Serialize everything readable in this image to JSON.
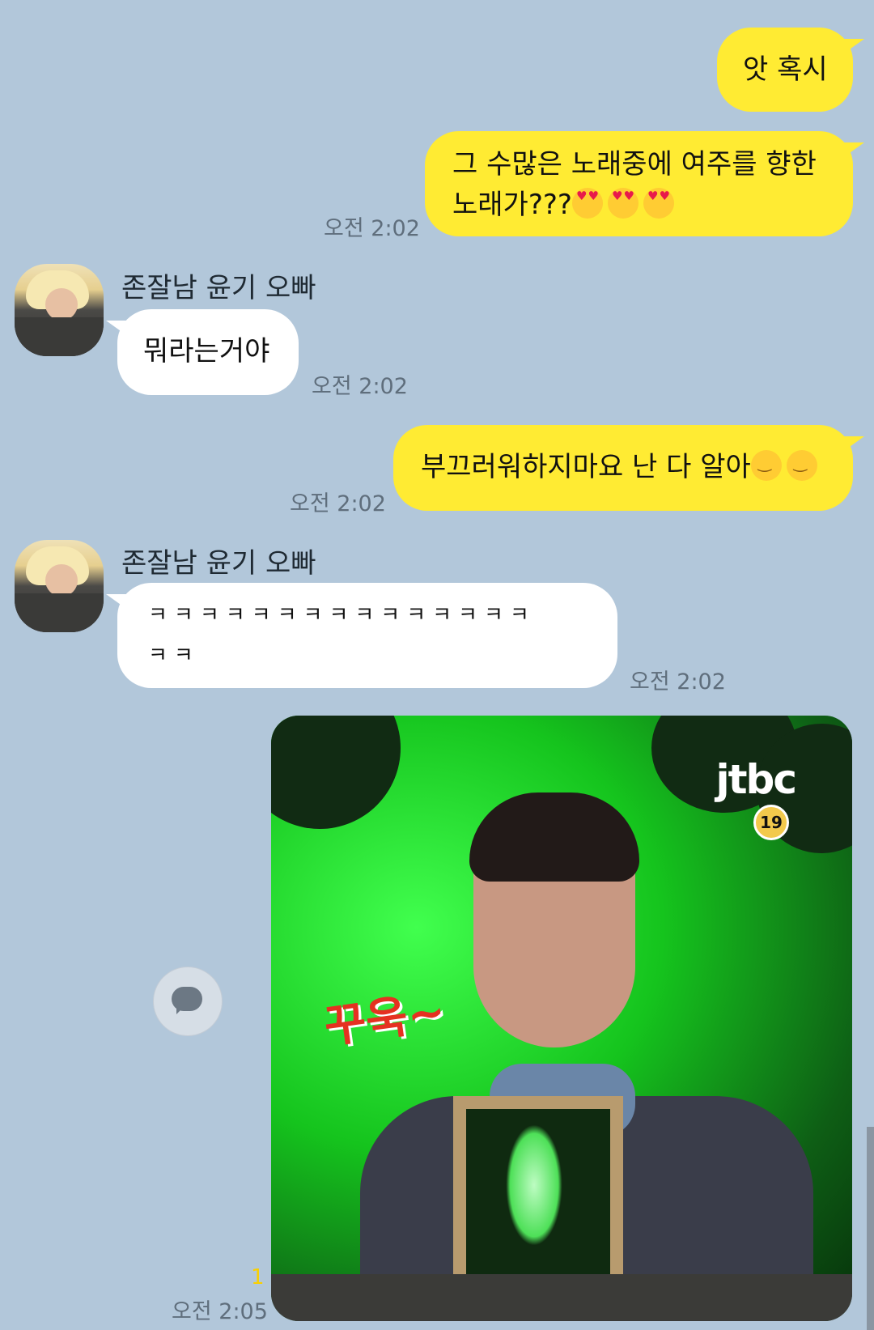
{
  "messages": [
    {
      "sender": "me",
      "text": "앗 혹시",
      "time": ""
    },
    {
      "sender": "me",
      "text_line1": "그 수많은 노래중에 여주를 향한",
      "text_line2": "노래가???",
      "emoji": [
        "heart-eyes-emoji",
        "heart-eyes-emoji",
        "heart-eyes-emoji"
      ],
      "time": "오전 2:02"
    },
    {
      "sender": "them",
      "name": "존잘남 윤기 오빠",
      "text": "뭐라는거야",
      "time": "오전 2:02"
    },
    {
      "sender": "me",
      "text": "부끄러워하지마요 난 다 알아",
      "emoji": [
        "smiling-emoji",
        "smiling-emoji"
      ],
      "time": "오전 2:02"
    },
    {
      "sender": "them",
      "name": "존잘남 윤기 오빠",
      "text_line1": "ㅋㅋㅋㅋㅋㅋㅋㅋㅋㅋㅋㅋㅋㅋㅋ",
      "text_line2": "ㅋㅋ",
      "time": "오전 2:02"
    },
    {
      "sender": "me",
      "type": "image",
      "image_desc": "tv-show-meme",
      "caption": "꾸욱~",
      "logo": "jtbc",
      "age_badge": "19",
      "unread": "1",
      "time": "오전 2:05"
    }
  ],
  "colors": {
    "background": "#b2c7da",
    "my_bubble": "#ffeb33",
    "their_bubble": "#ffffff"
  }
}
